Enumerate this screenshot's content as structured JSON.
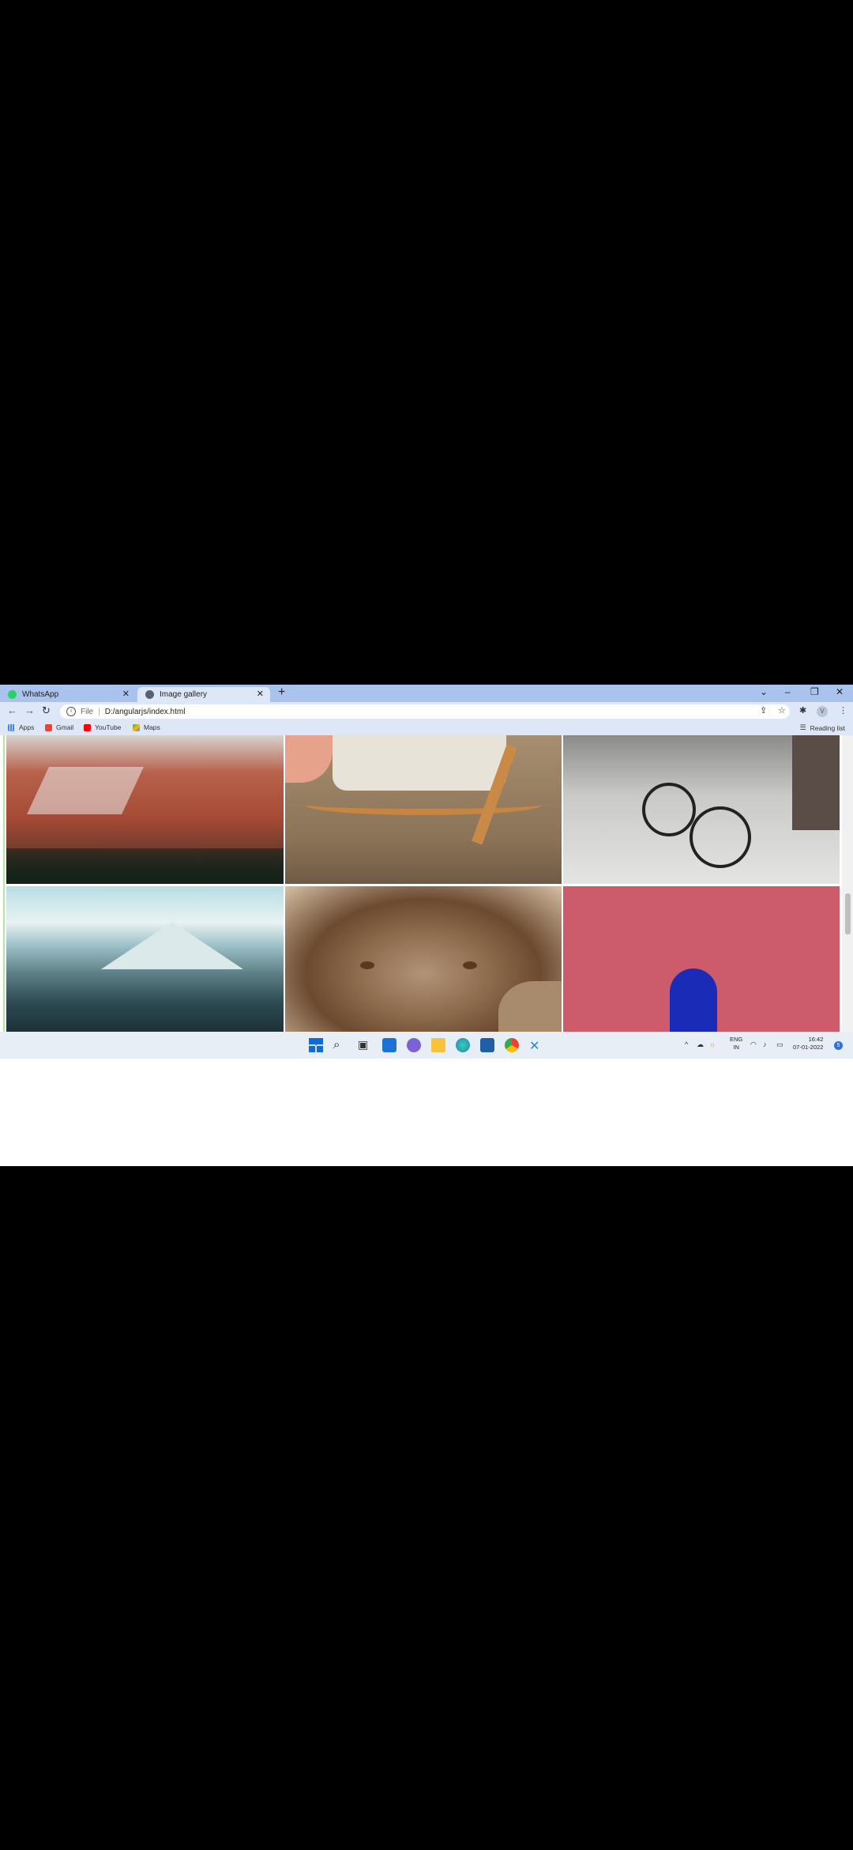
{
  "browser": {
    "tabs": [
      {
        "label": "WhatsApp",
        "favicon": "whatsapp-icon",
        "active": false
      },
      {
        "label": "Image gallery",
        "favicon": "globe-icon",
        "active": true
      }
    ],
    "address": {
      "scheme_label": "File",
      "url": "D:/angularjs/index.html"
    },
    "bookmarks": [
      {
        "label": "Apps",
        "icon": "apps-grid-icon"
      },
      {
        "label": "Gmail",
        "icon": "gmail-icon"
      },
      {
        "label": "YouTube",
        "icon": "youtube-icon"
      },
      {
        "label": "Maps",
        "icon": "maps-icon"
      }
    ],
    "reading_list": "Reading list",
    "profile_initial": "V"
  },
  "gallery": {
    "images": [
      {
        "subject": "mountain-rocks"
      },
      {
        "subject": "rocking-chair"
      },
      {
        "subject": "bicycles-snow"
      },
      {
        "subject": "snowy-mountains"
      },
      {
        "subject": "lion-face"
      },
      {
        "subject": "pink-wall-blue-door"
      }
    ]
  },
  "taskbar": {
    "lang": {
      "line1": "ENG",
      "line2": "IN"
    },
    "clock": {
      "time": "16:42",
      "date": "07-01-2022"
    },
    "notifications": "5"
  }
}
